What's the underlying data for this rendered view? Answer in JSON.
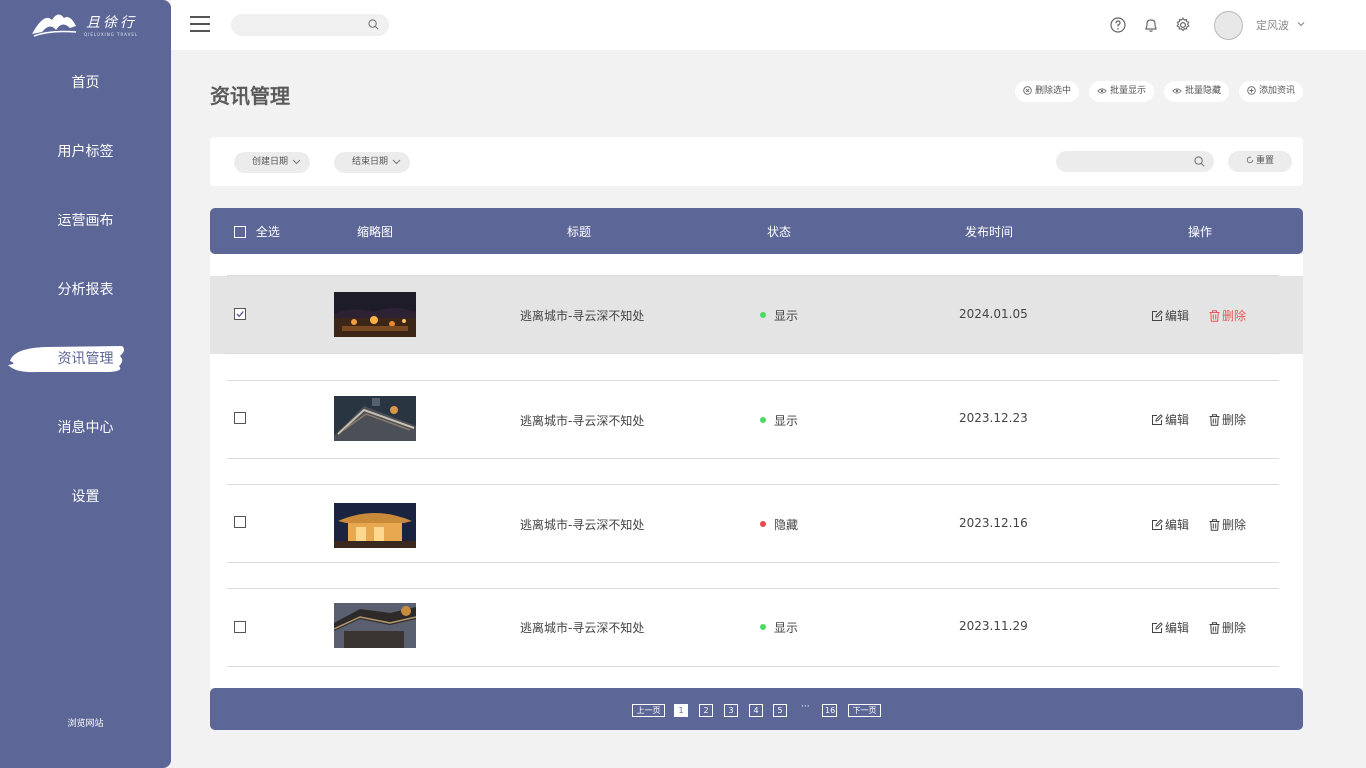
{
  "brand": {
    "name": "且徐行",
    "sub": "QIELUXING TRAVEL"
  },
  "sidebar": {
    "items": [
      {
        "label": "首页"
      },
      {
        "label": "用户标签"
      },
      {
        "label": "运营画布"
      },
      {
        "label": "分析报表"
      },
      {
        "label": "资讯管理",
        "active": true
      },
      {
        "label": "消息中心"
      },
      {
        "label": "设置"
      }
    ],
    "footer": "浏览网站"
  },
  "topbar": {
    "search_placeholder": "",
    "icons": [
      "help-icon",
      "bell-icon",
      "gear-icon"
    ],
    "username": "定风波"
  },
  "page": {
    "title": "资讯管理",
    "actions": [
      {
        "label": "删除选中",
        "icon": "close-circle-icon"
      },
      {
        "label": "批量显示",
        "icon": "eye-icon"
      },
      {
        "label": "批量隐藏",
        "icon": "eye-icon"
      },
      {
        "label": "添加资讯",
        "icon": "plus-circle-icon"
      }
    ]
  },
  "filters": {
    "start_date": "创建日期",
    "end_date": "结束日期",
    "search_placeholder": "",
    "reset": "重置"
  },
  "table": {
    "headers": {
      "select_all": "全选",
      "thumbnail": "缩略图",
      "title": "标题",
      "status": "状态",
      "publish_time": "发布时间",
      "actions": "操作"
    },
    "edit_label": "编辑",
    "delete_label": "删除",
    "rows": [
      {
        "checked": true,
        "title": "逃离城市-寻云深不知处",
        "status": "显示",
        "status_color": "#4cd964",
        "date": "2024.01.05",
        "thumb": "night-town-image"
      },
      {
        "checked": false,
        "title": "逃离城市-寻云深不知处",
        "status": "显示",
        "status_color": "#4cd964",
        "date": "2023.12.23",
        "thumb": "ancient-roof-image"
      },
      {
        "checked": false,
        "title": "逃离城市-寻云深不知处",
        "status": "隐藏",
        "status_color": "#e84a4a",
        "date": "2023.12.16",
        "thumb": "lit-pavilion-image"
      },
      {
        "checked": false,
        "title": "逃离城市-寻云深不知处",
        "status": "显示",
        "status_color": "#4cd964",
        "date": "2023.11.29",
        "thumb": "temple-eaves-image"
      }
    ]
  },
  "pagination": {
    "prev": "上一页",
    "next": "下一页",
    "pages": [
      "1",
      "2",
      "3",
      "4",
      "5"
    ],
    "ellipsis": "···",
    "last": "16",
    "current": "1"
  },
  "colors": {
    "primary": "#5c6797",
    "danger": "#e55a5a",
    "show": "#4cd964",
    "hide": "#e84a4a"
  }
}
